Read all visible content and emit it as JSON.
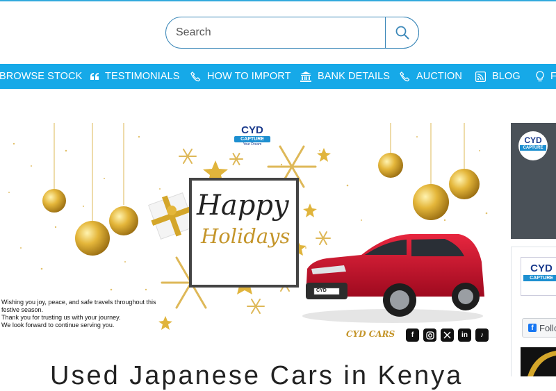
{
  "search": {
    "placeholder": "Search"
  },
  "nav": {
    "items": [
      {
        "label": "BROWSE STOCK",
        "icon": "none"
      },
      {
        "label": "TESTIMONIALS",
        "icon": "quote-icon"
      },
      {
        "label": "HOW TO IMPORT",
        "icon": "phone-icon"
      },
      {
        "label": "BANK DETAILS",
        "icon": "bank-icon"
      },
      {
        "label": "AUCTION",
        "icon": "phone-icon"
      },
      {
        "label": "BLOG",
        "icon": "rss-icon"
      },
      {
        "label": "F",
        "icon": "lightbulb-icon"
      }
    ]
  },
  "banner": {
    "logo_top": "CYD",
    "logo_bottom": "CAPTURE",
    "logo_tag": "Your Dream",
    "happy": "Happy",
    "holidays": "Holidays",
    "message": [
      "Wishing you joy, peace, and safe travels throughout this festive season.",
      "Thank you for trusting us with your journey.",
      "We look forward to continue serving you."
    ],
    "signature": "CYD CARS",
    "plate": "CYD"
  },
  "sidebar": {
    "follow_label": "Follo",
    "logo_top": "CYD",
    "logo_bottom": "CAPTURE"
  },
  "heading": "Used Japanese Cars in Kenya",
  "colors": {
    "nav_bg": "#16a9e8",
    "search_border": "#3a87b8",
    "gold": "#d4a62a",
    "car_red": "#c8102e"
  }
}
